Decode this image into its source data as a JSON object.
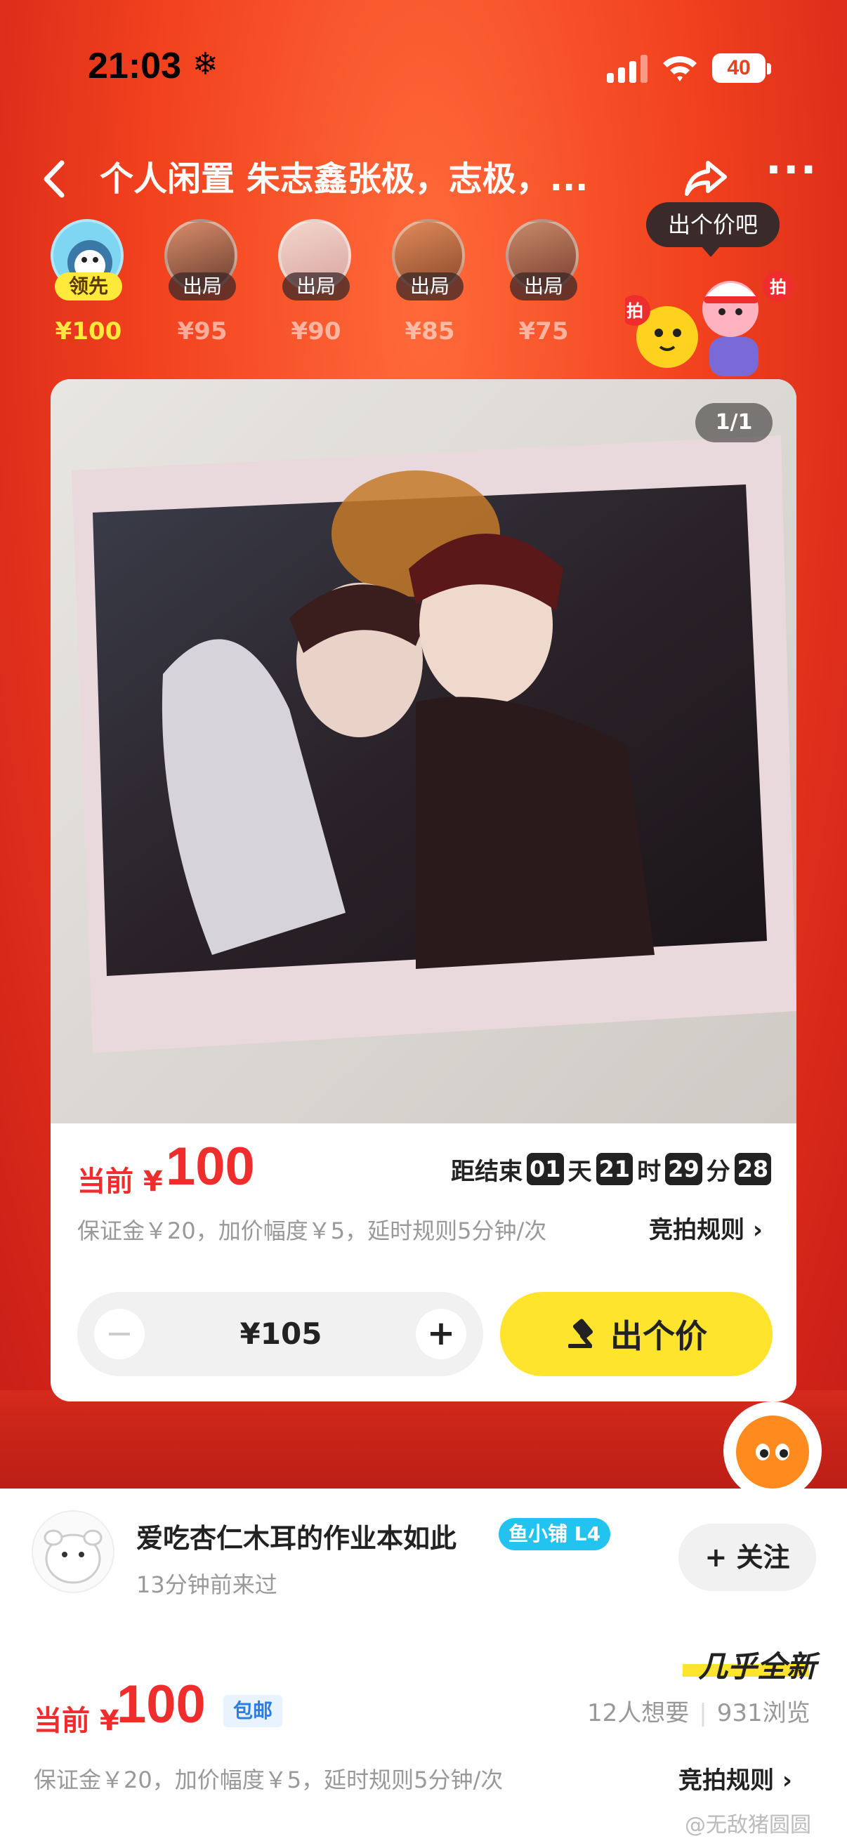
{
  "status": {
    "time": "21:03",
    "snow_icon": "❄",
    "battery": "40"
  },
  "nav": {
    "title": "个人闲置 朱志鑫张极，志极，..."
  },
  "bidders": [
    {
      "tag": "领先",
      "price": "¥100",
      "lead": true
    },
    {
      "tag": "出局",
      "price": "¥95",
      "lead": false
    },
    {
      "tag": "出局",
      "price": "¥90",
      "lead": false
    },
    {
      "tag": "出局",
      "price": "¥85",
      "lead": false
    },
    {
      "tag": "出局",
      "price": "¥75",
      "lead": false
    }
  ],
  "bubble": "出个价吧",
  "mascot_labels": {
    "left": "拍",
    "right": "拍"
  },
  "card": {
    "page_indicator": "1/1",
    "current_label": "当前 ¥",
    "current_value": "100",
    "countdown": {
      "prefix": "距结束",
      "days": "01",
      "days_label": "天",
      "hours": "21",
      "hours_label": "时",
      "minutes": "29",
      "minutes_label": "分",
      "seconds": "28"
    },
    "rules_text": "保证金￥20，加价幅度￥5，延时规则5分钟/次",
    "rules_link": "竞拍规则",
    "stepper": {
      "minus": "−",
      "value": "¥105",
      "plus": "+"
    },
    "bid_button": "出个价"
  },
  "seller": {
    "name": "爱吃杏仁木耳的作业本如此",
    "badge": "鱼小铺 L4",
    "last_seen": "13分钟前来过",
    "follow": "+ 关注"
  },
  "item": {
    "condition": "几乎全新",
    "current_label": "当前 ¥",
    "current_value": "100",
    "shipping": "包邮",
    "wants": "12人想要",
    "views": "931浏览",
    "rules_text": "保证金￥20，加价幅度￥5，延时规则5分钟/次",
    "rules_link": "竞拍规则"
  },
  "watermark": "@无敌猪圆圆",
  "colors": {
    "accent_red": "#f02d2d",
    "bid_yellow": "#ffe42d",
    "badge_blue": "#23c3ef"
  }
}
